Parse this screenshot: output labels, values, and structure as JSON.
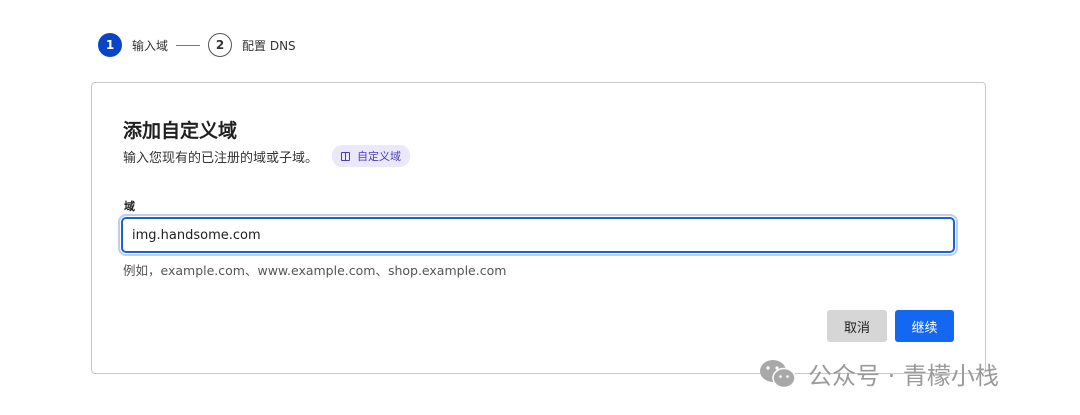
{
  "stepper": {
    "steps": [
      {
        "number": "1",
        "label": "输入域",
        "active": true
      },
      {
        "number": "2",
        "label": "配置 DNS",
        "active": false
      }
    ]
  },
  "card": {
    "title": "添加自定义域",
    "subtitle": "输入您现有的已注册的域或子域。",
    "doc_link_label": "自定义域",
    "field_label": "域",
    "input_value": "img.handsome.com",
    "help_text": "例如，example.com、www.example.com、shop.example.com",
    "cancel_label": "取消",
    "continue_label": "继续"
  },
  "watermark": {
    "text": "公众号 · 青檬小栈",
    "icon": "wechat-icon"
  },
  "colors": {
    "accent": "#1467f1",
    "step_active": "#0b45c7",
    "badge_bg": "#ece8fb"
  }
}
